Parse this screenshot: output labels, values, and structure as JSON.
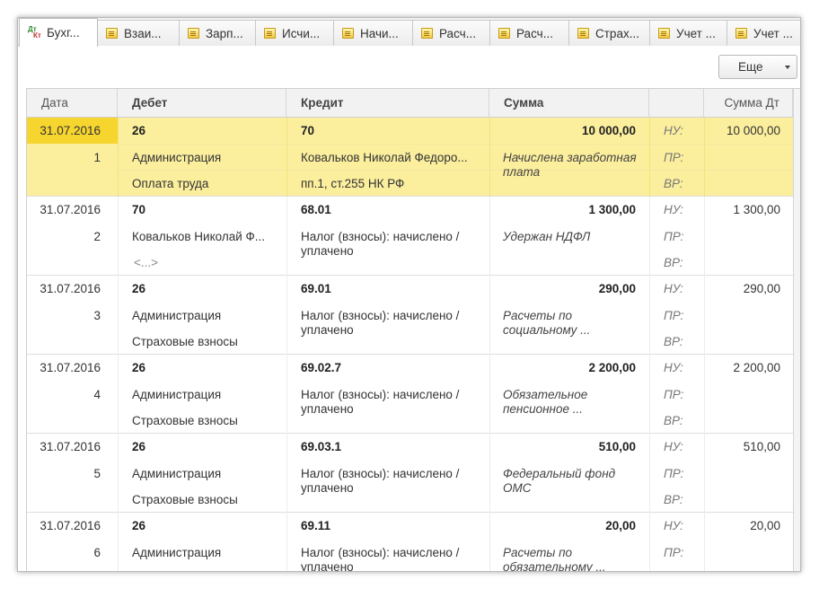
{
  "tabs": [
    {
      "label": "Бухг...",
      "icon": "dt-kt-icon",
      "active": true
    },
    {
      "label": "Взаи...",
      "icon": "document-icon"
    },
    {
      "label": "Зарп...",
      "icon": "document-icon"
    },
    {
      "label": "Исчи...",
      "icon": "document-icon"
    },
    {
      "label": "Начи...",
      "icon": "document-icon"
    },
    {
      "label": "Расч...",
      "icon": "document-icon"
    },
    {
      "label": "Расч...",
      "icon": "document-icon"
    },
    {
      "label": "Страх...",
      "icon": "document-icon"
    },
    {
      "label": "Учет ...",
      "icon": "document-icon"
    },
    {
      "label": "Учет ...",
      "icon": "document-icon"
    }
  ],
  "more_button": "Еще",
  "columns": {
    "date": "Дата",
    "debit": "Дебет",
    "credit": "Кредит",
    "sum": "Сумма",
    "sum_dt": "Сумма Дт"
  },
  "tax_labels": {
    "nu": "НУ:",
    "pr": "ПР:",
    "vr": "ВР:"
  },
  "rows": [
    {
      "date": "31.07.2016",
      "num": "1",
      "debit": "26",
      "debit_sub1": "Администрация",
      "debit_sub2": "Оплата труда",
      "credit": "70",
      "credit_sub1": "Ковальков  Николай Федоро...",
      "credit_sub2": "пп.1, ст.255 НК РФ",
      "sum": "10 000,00",
      "content": "Начислена заработная плата",
      "sum_dt": "10 000,00"
    },
    {
      "date": "31.07.2016",
      "num": "2",
      "debit": "70",
      "debit_sub1": "Ковальков  Николай Ф...",
      "debit_sub2": "<...>",
      "credit": "68.01",
      "credit_sub1": "Налог (взносы): начислено / уплачено",
      "credit_sub2": "",
      "sum": "1 300,00",
      "content": "Удержан НДФЛ",
      "sum_dt": "1 300,00"
    },
    {
      "date": "31.07.2016",
      "num": "3",
      "debit": "26",
      "debit_sub1": "Администрация",
      "debit_sub2": "Страховые взносы",
      "credit": "69.01",
      "credit_sub1": "Налог (взносы): начислено / уплачено",
      "credit_sub2": "",
      "sum": "290,00",
      "content": "Расчеты по социальному ...",
      "sum_dt": "290,00"
    },
    {
      "date": "31.07.2016",
      "num": "4",
      "debit": "26",
      "debit_sub1": "Администрация",
      "debit_sub2": "Страховые взносы",
      "credit": "69.02.7",
      "credit_sub1": "Налог (взносы): начислено / уплачено",
      "credit_sub2": "",
      "sum": "2 200,00",
      "content": "Обязательное пенсионное ...",
      "sum_dt": "2 200,00"
    },
    {
      "date": "31.07.2016",
      "num": "5",
      "debit": "26",
      "debit_sub1": "Администрация",
      "debit_sub2": "Страховые взносы",
      "credit": "69.03.1",
      "credit_sub1": "Налог (взносы): начислено / уплачено",
      "credit_sub2": "",
      "sum": "510,00",
      "content": "Федеральный фонд ОМС",
      "sum_dt": "510,00"
    },
    {
      "date": "31.07.2016",
      "num": "6",
      "debit": "26",
      "debit_sub1": "Администрация",
      "debit_sub2": "",
      "credit": "69.11",
      "credit_sub1": "Налог (взносы): начислено / уплачено",
      "credit_sub2": "",
      "sum": "20,00",
      "content": "Расчеты по обязательному ...",
      "sum_dt": "20,00"
    }
  ]
}
